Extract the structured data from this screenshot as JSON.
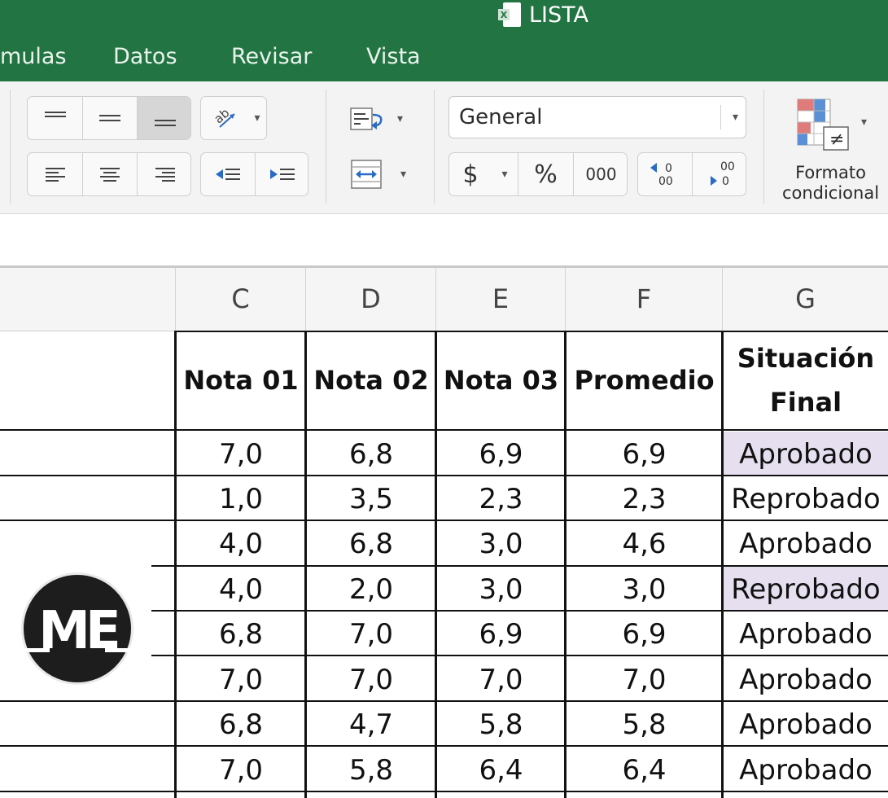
{
  "window": {
    "title": "LISTA"
  },
  "tabs": [
    "mulas",
    "Datos",
    "Revisar",
    "Vista"
  ],
  "ribbon": {
    "number_format": "General",
    "currency_symbol": "$",
    "percent_symbol": "%",
    "thousands_label": "000",
    "conditional_format_label": [
      "Formato",
      "condicional"
    ]
  },
  "columns": [
    "C",
    "D",
    "E",
    "F",
    "G"
  ],
  "table": {
    "headers": [
      "Nota 01",
      "Nota 02",
      "Nota 03",
      "Promedio",
      "Situación\nFinal"
    ],
    "rows": [
      [
        "7,0",
        "6,8",
        "6,9",
        "6,9",
        "Aprobado"
      ],
      [
        "1,0",
        "3,5",
        "2,3",
        "2,3",
        "Reprobado"
      ],
      [
        "4,0",
        "6,8",
        "3,0",
        "4,6",
        "Aprobado"
      ],
      [
        "4,0",
        "2,0",
        "3,0",
        "3,0",
        "Reprobado"
      ],
      [
        "6,8",
        "7,0",
        "6,9",
        "6,9",
        "Aprobado"
      ],
      [
        "7,0",
        "7,0",
        "7,0",
        "7,0",
        "Aprobado"
      ],
      [
        "6,8",
        "4,7",
        "5,8",
        "5,8",
        "Aprobado"
      ],
      [
        "7,0",
        "5,8",
        "6,4",
        "6,4",
        "Aprobado"
      ]
    ]
  },
  "logo": {
    "text": "ME"
  },
  "colors": {
    "excel_green": "#237443",
    "highlight": "#e6dff0"
  },
  "icons": [
    "excel-doc-icon",
    "align-top-icon",
    "align-middle-icon",
    "align-bottom-icon",
    "text-orientation-icon",
    "align-left-icon",
    "align-center-icon",
    "align-right-icon",
    "decrease-indent-icon",
    "increase-indent-icon",
    "wrap-text-icon",
    "merge-cells-icon",
    "increase-decimal-icon",
    "decrease-decimal-icon",
    "conditional-format-icon"
  ]
}
